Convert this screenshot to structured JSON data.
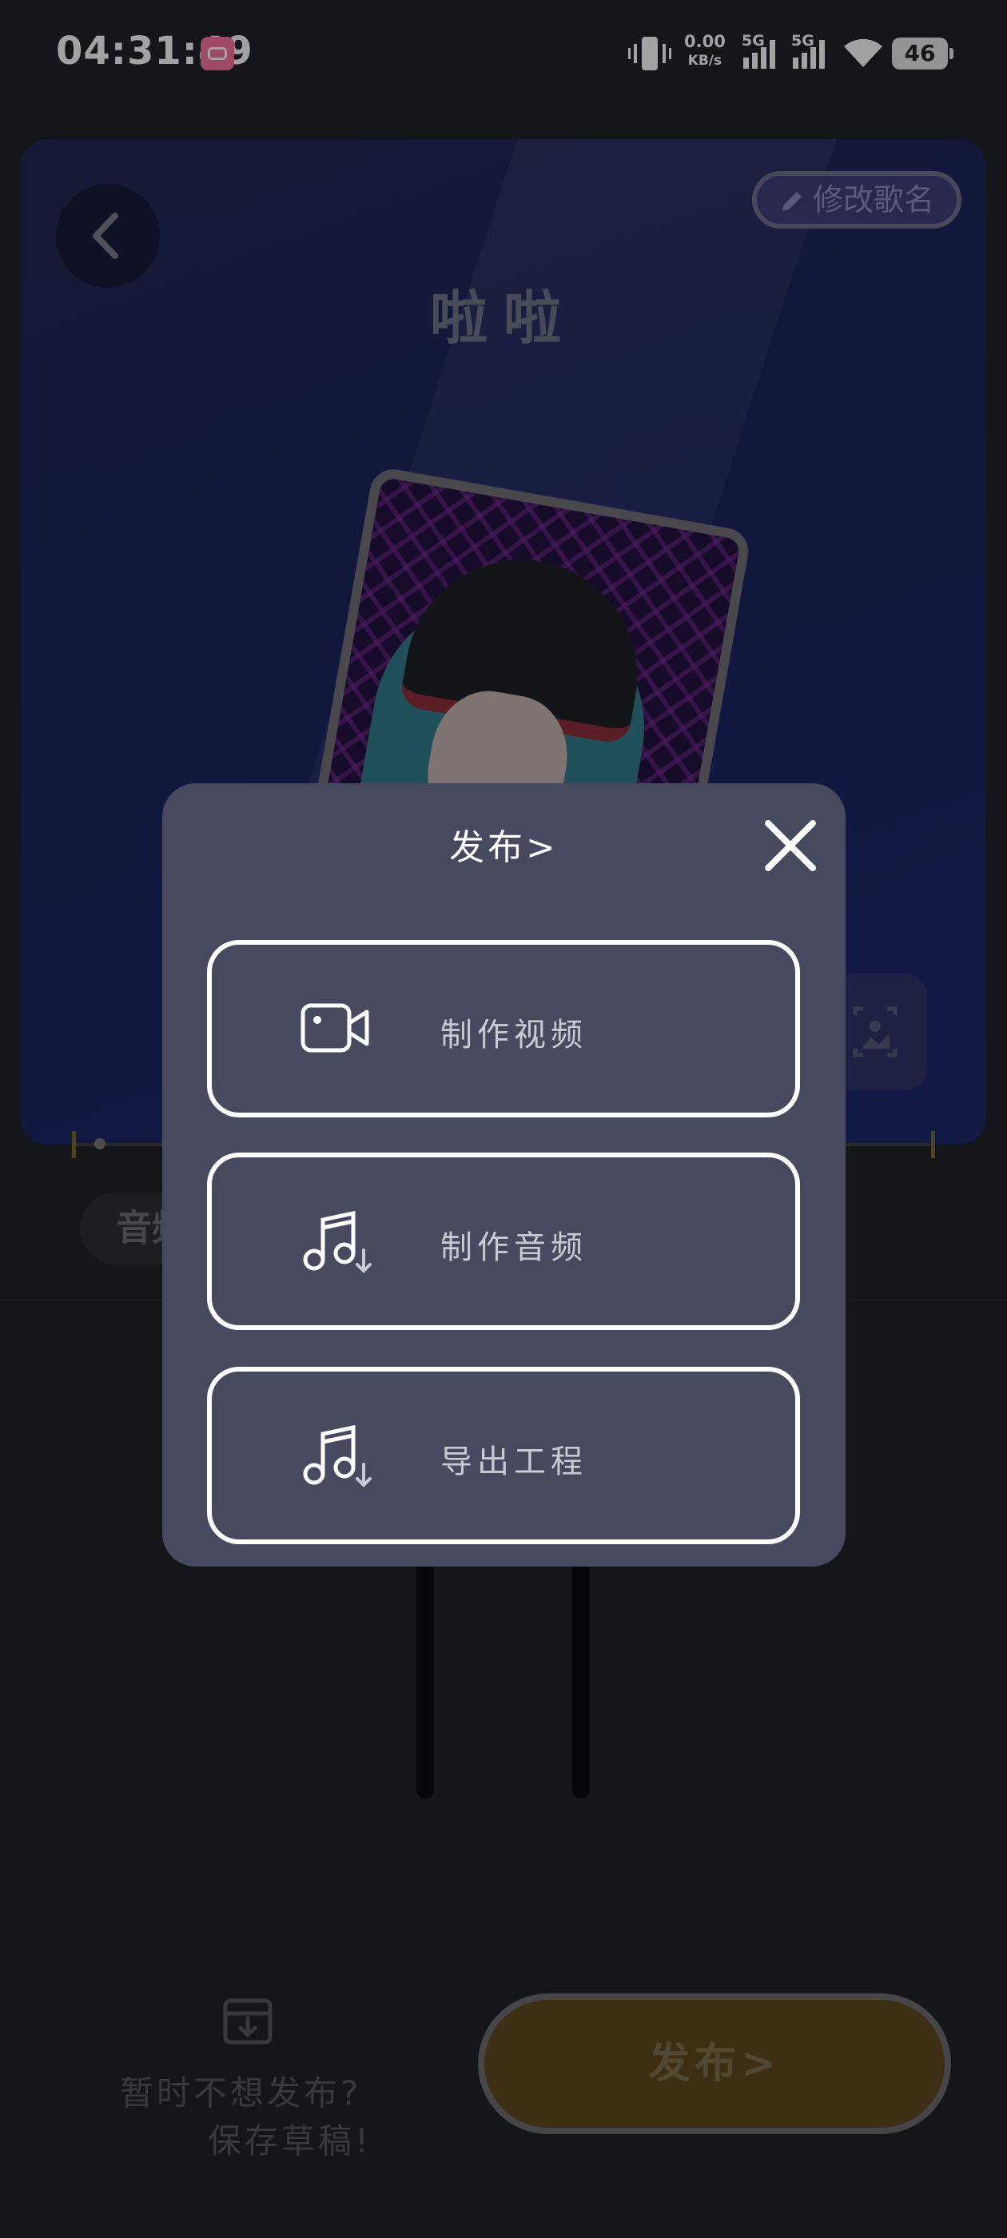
{
  "status_bar": {
    "time": "04:31:49",
    "net_speed_value": "0.00",
    "net_speed_unit": "KB/s",
    "sim1": "5G",
    "sim2": "5G",
    "battery": "46"
  },
  "editor": {
    "rename_label": "修改歌名",
    "song_title": "啦啦",
    "track_chip_label": "音频"
  },
  "dialog": {
    "title": "发布>",
    "options": [
      {
        "label": "制作视频",
        "icon": "video-camera-icon"
      },
      {
        "label": "制作音频",
        "icon": "music-download-icon"
      },
      {
        "label": "导出工程",
        "icon": "music-download-icon"
      }
    ]
  },
  "bottom": {
    "draft_line1": "暂时不想发布?",
    "draft_line2": "保存草稿!",
    "publish_label": "发布>"
  },
  "colors": {
    "dialog_bg": "#474a5e",
    "publish_button": "#5c4617",
    "accent_pink": "#fb7299"
  }
}
